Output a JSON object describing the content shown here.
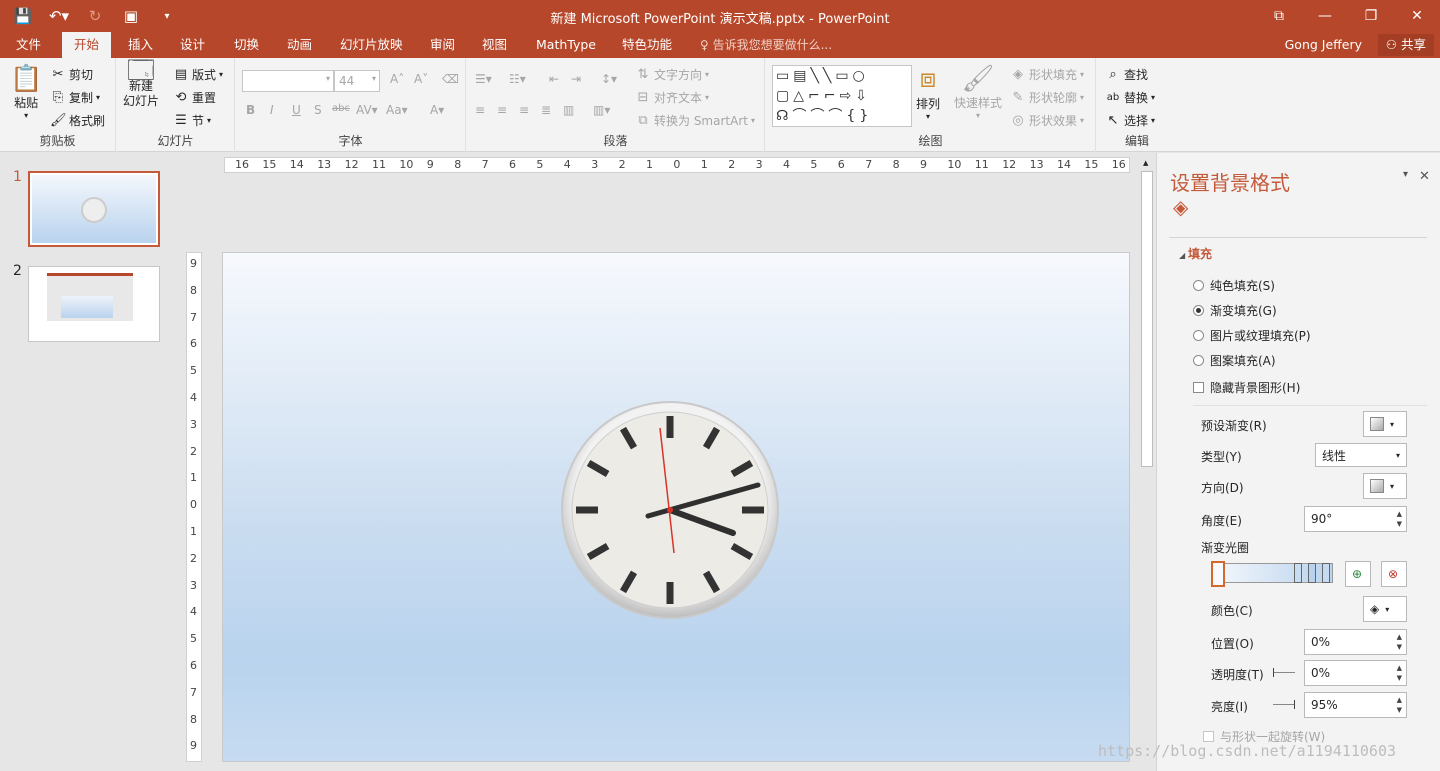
{
  "window": {
    "title": "新建 Microsoft PowerPoint 演示文稿.pptx - PowerPoint",
    "restore_icon": "restore-icon",
    "min_icon": "minimize-icon"
  },
  "tabs": [
    {
      "label": "文件",
      "active": false
    },
    {
      "label": "开始",
      "active": true
    },
    {
      "label": "插入",
      "active": false
    },
    {
      "label": "设计",
      "active": false
    },
    {
      "label": "切换",
      "active": false
    },
    {
      "label": "动画",
      "active": false
    },
    {
      "label": "幻灯片放映",
      "active": false
    },
    {
      "label": "审阅",
      "active": false
    },
    {
      "label": "视图",
      "active": false
    },
    {
      "label": "MathType",
      "active": false
    },
    {
      "label": "特色功能",
      "active": false
    }
  ],
  "tellme": "告诉我您想要做什么...",
  "user": "Gong Jeffery",
  "share": "共享",
  "ribbon": {
    "clipboard": {
      "label": "剪贴板",
      "paste": "粘贴",
      "cut": "剪切",
      "copy": "复制",
      "format_painter": "格式刷"
    },
    "slides": {
      "label": "幻灯片",
      "new_slide_1": "新建",
      "new_slide_2": "幻灯片",
      "layout": "版式",
      "reset": "重置",
      "section": "节"
    },
    "font": {
      "label": "字体",
      "size": "44"
    },
    "paragraph": {
      "label": "段落",
      "text_direction": "文字方向",
      "align_text": "对齐文本",
      "smartart": "转换为 SmartArt"
    },
    "drawing": {
      "label": "绘图",
      "arrange": "排列",
      "quick_styles": "快速样式",
      "shape_fill": "形状填充",
      "shape_outline": "形状轮廓",
      "shape_effects": "形状效果"
    },
    "editing": {
      "label": "编辑",
      "find": "查找",
      "replace": "替换",
      "select": "选择"
    }
  },
  "thumbnails": [
    {
      "number": "1",
      "selected": true
    },
    {
      "number": "2",
      "selected": false
    }
  ],
  "ruler_h_ticks": [
    "16",
    "15",
    "14",
    "13",
    "12",
    "11",
    "10",
    "9",
    "8",
    "7",
    "6",
    "5",
    "4",
    "3",
    "2",
    "1",
    "0",
    "1",
    "2",
    "3",
    "4",
    "5",
    "6",
    "7",
    "8",
    "9",
    "10",
    "11",
    "12",
    "13",
    "14",
    "15",
    "16"
  ],
  "ruler_v_ticks": [
    "9",
    "8",
    "7",
    "6",
    "5",
    "4",
    "3",
    "2",
    "1",
    "0",
    "1",
    "2",
    "3",
    "4",
    "5",
    "6",
    "7",
    "8",
    "9"
  ],
  "pane": {
    "title": "设置背景格式",
    "section": "填充",
    "options": [
      {
        "label": "纯色填充(S)",
        "checked": false
      },
      {
        "label": "渐变填充(G)",
        "checked": true
      },
      {
        "label": "图片或纹理填充(P)",
        "checked": false
      },
      {
        "label": "图案填充(A)",
        "checked": false
      }
    ],
    "hide_bg": "隐藏背景图形(H)",
    "preset_label": "预设渐变(R)",
    "type_label": "类型(Y)",
    "type_value": "线性",
    "direction_label": "方向(D)",
    "angle_label": "角度(E)",
    "angle_value": "90°",
    "stops_label": "渐变光圈",
    "color_label": "颜色(C)",
    "position_label": "位置(O)",
    "position_value": "0%",
    "transparency_label": "透明度(T)",
    "transparency_value": "0%",
    "brightness_label": "亮度(I)",
    "brightness_value": "95%",
    "rotate_label": "与形状一起旋转(W)"
  },
  "watermark": "https://blog.csdn.net/a1194110603",
  "colors": {
    "accent": "#b7472a",
    "pane_accent": "#c55a3b"
  }
}
